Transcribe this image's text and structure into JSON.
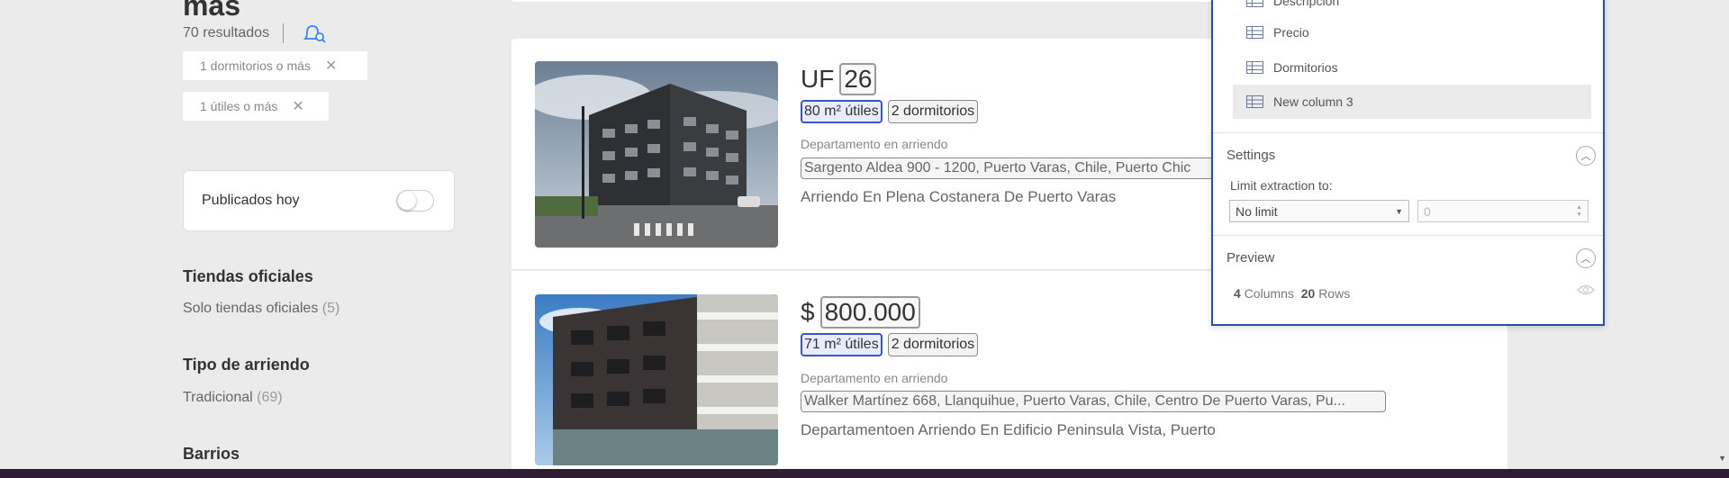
{
  "sidebar": {
    "title": "más",
    "results": "70 resultados",
    "chips": [
      {
        "label": "1 dormitorios o más"
      },
      {
        "label": "1 útiles o más"
      }
    ],
    "toggle": {
      "label": "Publicados hoy",
      "on": false
    },
    "sections": [
      {
        "title": "Tiendas oficiales",
        "item": "Solo tiendas oficiales",
        "count": "(5)"
      },
      {
        "title": "Tipo de arriendo",
        "item": "Tradicional",
        "count": "(69)"
      },
      {
        "title": "Barrios"
      }
    ]
  },
  "listings": [
    {
      "currency": "UF",
      "price": "26",
      "area": "80 m² útiles",
      "bedrooms": "2 dormitorios",
      "type": "Departamento en arriendo",
      "address": "Sargento Aldea 900 - 1200, Puerto Varas, Chile, Puerto Chic",
      "description": "Arriendo En Plena Costanera De Puerto Varas"
    },
    {
      "currency": "$",
      "price": "800.000",
      "area": "71 m² útiles",
      "bedrooms": "2 dormitorios",
      "type": "Departamento en arriendo",
      "address": "Walker Martínez 668, Llanquihue, Puerto Varas, Chile, Centro De Puerto Varas, Pu...",
      "description": "Departamentoen Arriendo En Edificio Peninsula Vista, Puerto"
    }
  ],
  "panel": {
    "columns": [
      "Descripcion",
      "Precio",
      "Dormitorios",
      "New column 3"
    ],
    "settings_title": "Settings",
    "limit_label": "Limit extraction to:",
    "limit_value": "No limit",
    "limit_number": "0",
    "preview_title": "Preview",
    "preview": {
      "columns_count": "4",
      "columns_label": "Columns",
      "rows_count": "20",
      "rows_label": "Rows"
    }
  },
  "colors": {
    "accent": "#2a4ea6",
    "selection": "#3b55c7",
    "bottom_bar": "#2f1d34"
  }
}
